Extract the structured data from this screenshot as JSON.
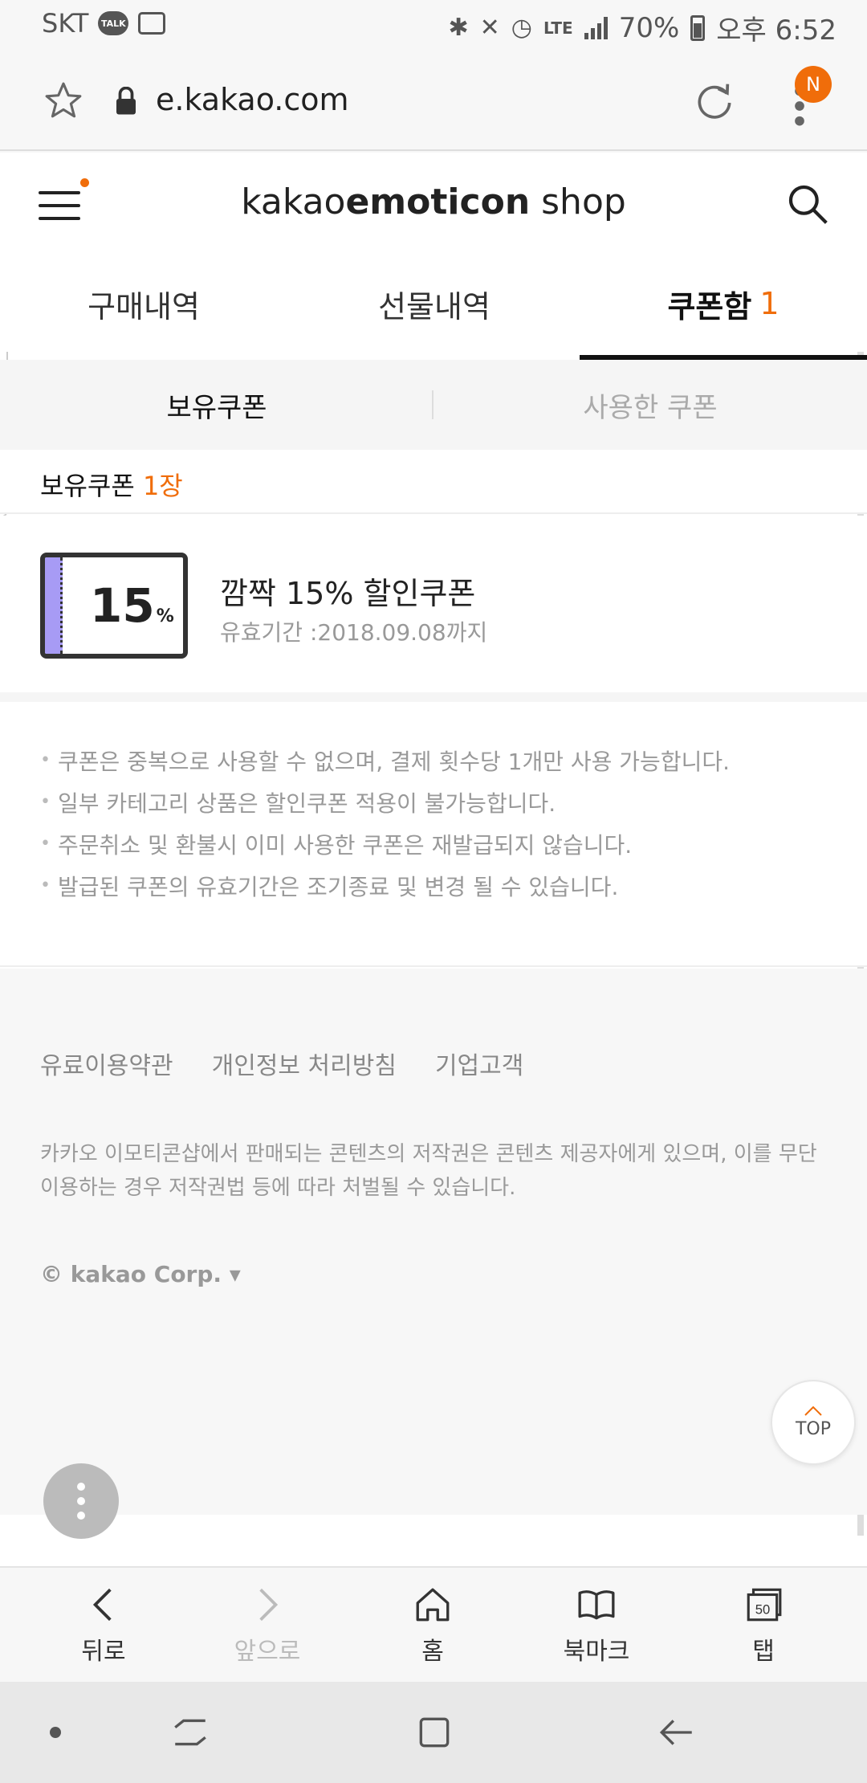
{
  "status_bar": {
    "carrier": "SKT",
    "talk_badge": "TALK",
    "lte": "LTE",
    "battery": "70%",
    "time": "오후 6:52"
  },
  "browser": {
    "url": "e.kakao.com",
    "notification_badge": "N"
  },
  "site": {
    "logo_light": "kakao",
    "logo_bold": "emoticon",
    "logo_suffix": " shop"
  },
  "tabs": [
    {
      "label": "구매내역",
      "count": ""
    },
    {
      "label": "선물내역",
      "count": ""
    },
    {
      "label": "쿠폰함",
      "count": "1"
    }
  ],
  "subtabs": [
    {
      "label": "보유쿠폰"
    },
    {
      "label": "사용한 쿠폰"
    }
  ],
  "coupon_count": {
    "label": "보유쿠폰",
    "value": "1장"
  },
  "coupon": {
    "percent": "15",
    "percent_sign": "%",
    "title": "깜짝 15% 할인쿠폰",
    "expire": "유효기간 :2018.09.08까지",
    "stripe_color": "#a79bf5"
  },
  "notices": [
    "쿠폰은 중복으로 사용할 수 없으며, 결제 횟수당 1개만 사용 가능합니다.",
    "일부 카테고리 상품은 할인쿠폰 적용이 불가능합니다.",
    "주문취소 및 환불시 이미 사용한 쿠폰은 재발급되지 않습니다.",
    "발급된 쿠폰의 유효기간은 조기종료 및 변경 될 수 있습니다."
  ],
  "footer": {
    "links": [
      "유료이용약관",
      "개인정보 처리방침",
      "기업고객"
    ],
    "copyright_notice": "카카오 이모티콘샵에서 판매되는 콘텐츠의 저작권은 콘텐츠 제공자에게 있으며, 이를 무단 이용하는 경우 저작권법 등에 따라 처벌될 수 있습니다.",
    "corp": "© kakao Corp. ▾"
  },
  "top_button": "TOP",
  "toolbar": {
    "back": "뒤로",
    "forward": "앞으로",
    "home": "홈",
    "bookmark": "북마크",
    "tabs": "탭",
    "tab_count": "50"
  },
  "colors": {
    "accent": "#f06d0a"
  }
}
